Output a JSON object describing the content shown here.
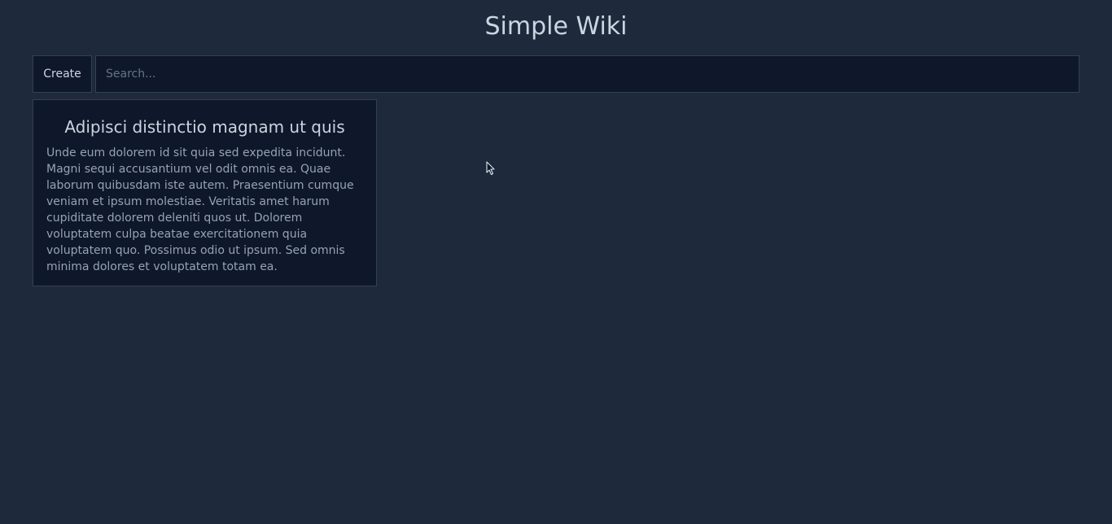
{
  "header": {
    "title": "Simple Wiki"
  },
  "toolbar": {
    "create_label": "Create",
    "search_placeholder": "Search...",
    "search_value": ""
  },
  "articles": [
    {
      "title": "Adipisci distinctio magnam ut quis",
      "excerpt": "Unde eum dolorem id sit quia sed expedita incidunt. Magni sequi accusantium vel odit omnis ea. Quae laborum quibusdam iste autem. Praesentium cumque veniam et ipsum molestiae. Veritatis amet harum cupiditate dolorem deleniti quos ut. Dolorem voluptatem culpa beatae exercitationem quia voluptatem quo. Possimus odio ut ipsum. Sed omnis minima dolores et voluptatem totam ea."
    }
  ],
  "colors": {
    "background": "#1e293b",
    "surface": "#0f172a",
    "border": "#334155",
    "text_primary": "#cbd5e1",
    "text_secondary": "#94a3b8",
    "placeholder": "#64748b"
  },
  "icons": {
    "cursor": "mouse-pointer-icon"
  }
}
